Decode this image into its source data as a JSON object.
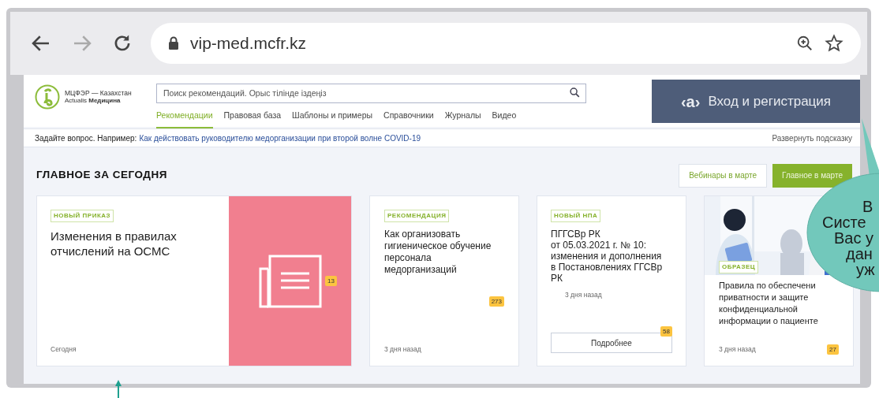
{
  "browser": {
    "url": "vip-med.mcfr.kz",
    "forward_disabled": true
  },
  "header": {
    "logo": {
      "line1": "МЦФЭР — Казахстан",
      "line2": "Actualis **Медицина**"
    },
    "search": {
      "placeholder": "Поиск рекомендаций. Орыс тілінде іздеңіз"
    },
    "nav": [
      {
        "label": "Рекомендации",
        "selected": true
      },
      {
        "label": "Правовая база",
        "selected": false
      },
      {
        "label": "Шаблоны и примеры",
        "selected": false
      },
      {
        "label": "Справочники",
        "selected": false
      },
      {
        "label": "Журналы",
        "selected": false
      },
      {
        "label": "Видео",
        "selected": false
      }
    ],
    "login": {
      "mark": "‹a›",
      "label": "Вход и регистрация"
    }
  },
  "question_bar": {
    "prompt": "Задайте вопрос. Например:",
    "link": "Как действовать руководителю медорганизации при второй волне COVID-19",
    "expand": "Развернуть подсказку"
  },
  "section": {
    "title": "ГЛАВНОЕ ЗА СЕГОДНЯ",
    "buttons": [
      {
        "label": "Вебинары в марте",
        "kind": "outline"
      },
      {
        "label": "Главное в марте",
        "kind": "primary"
      }
    ],
    "cards": [
      {
        "kind": "feature",
        "tag": "НОВЫЙ ПРИКАЗ",
        "title": "Изменения в правилах\nотчислений на ОСМС",
        "time": "Сегодня",
        "count": "13"
      },
      {
        "kind": "plain",
        "tag": "РЕКОМЕНДАЦИЯ",
        "title": "Как организовать\nгигиеническое обучение\nперсонала\nмедорганизаций",
        "time": "3 дня назад",
        "count": "273"
      },
      {
        "kind": "button",
        "tag": "НОВЫЙ НПА",
        "title": "ПГГСВр РК\nот 05.03.2021 г. № 10:\nизменения и дополнения\nв Постановлениях ГГСВр\nРК",
        "time": "3 дня назад",
        "button": "Подробнее",
        "count": "58"
      },
      {
        "kind": "picture",
        "tag": "ОБРАЗЕЦ",
        "title": "Правила по обеспечени\nприватности и защите\nконфиденциальной\nинформации о пациенте",
        "time": "3 дня назад",
        "count": "27"
      }
    ]
  },
  "callout": {
    "lines": [
      "В",
      "Систе",
      "Вас у",
      "дан",
      "уж"
    ]
  }
}
